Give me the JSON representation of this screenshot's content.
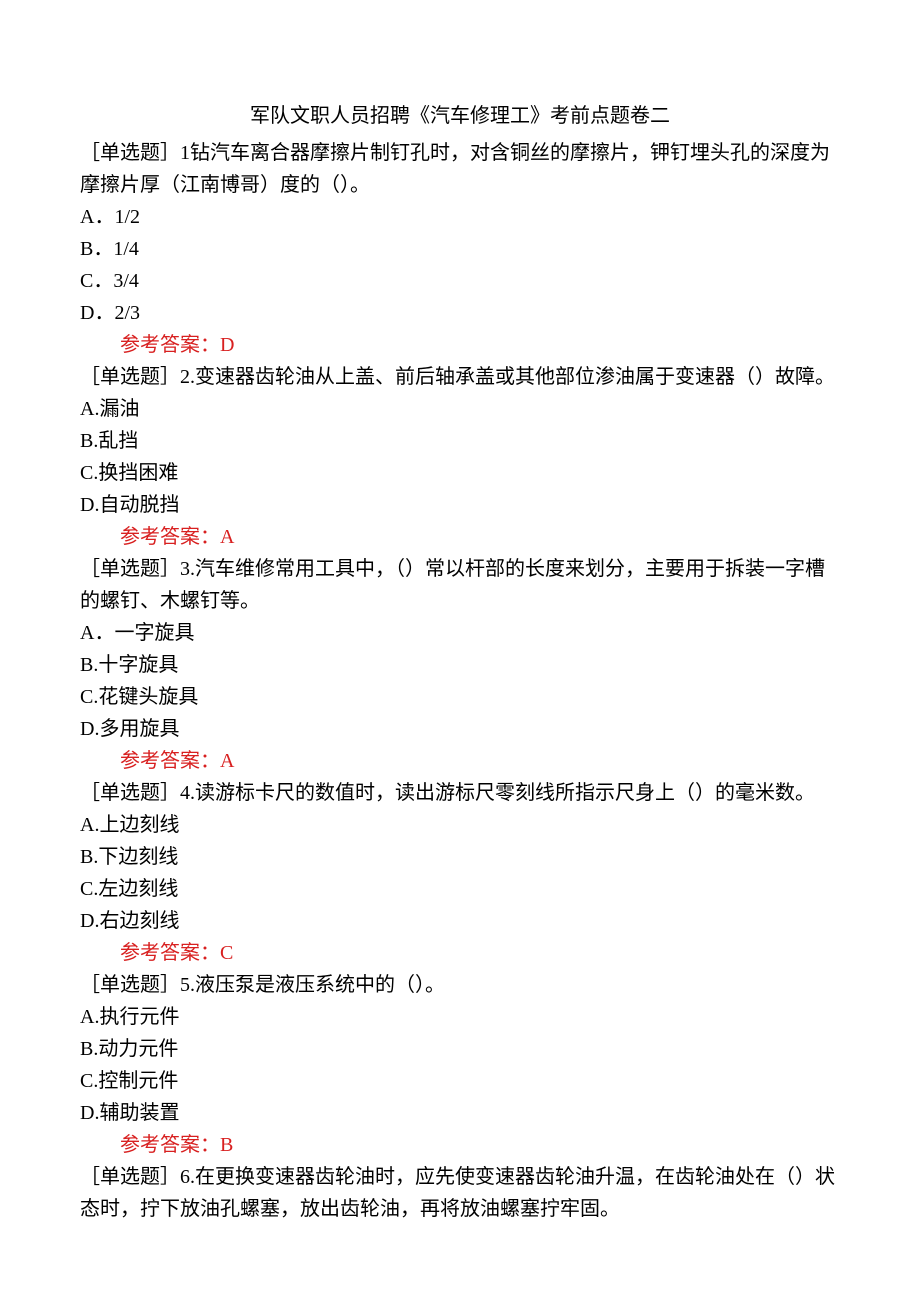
{
  "title": "军队文职人员招聘《汽车修理工》考前点题卷二",
  "questions": [
    {
      "label": "［单选题］1钻汽车离合器摩擦片制钉孔时，对含铜丝的摩擦片，钾钉埋头孔的深度为摩擦片厚（江南博哥）度的（）。",
      "options": {
        "a": "A．1/2",
        "b": "B．1/4",
        "c": "C．3/4",
        "d": "D．2/3"
      },
      "answer": "参考答案：D"
    },
    {
      "label": "［单选题］2.变速器齿轮油从上盖、前后轴承盖或其他部位渗油属于变速器（）故障。",
      "options": {
        "a": "A.漏油",
        "b": "B.乱挡",
        "c": "C.换挡困难",
        "d": "D.自动脱挡"
      },
      "answer": "参考答案：A"
    },
    {
      "label": "［单选题］3.汽车维修常用工具中，（）常以杆部的长度来划分，主要用于拆装一字槽的螺钉、木螺钉等。",
      "options": {
        "a": "A．一字旋具",
        "b": "B.十字旋具",
        "c": "C.花键头旋具",
        "d": "D.多用旋具"
      },
      "answer": "参考答案：A"
    },
    {
      "label": "［单选题］4.读游标卡尺的数值时，读出游标尺零刻线所指示尺身上（）的毫米数。",
      "options": {
        "a": "A.上边刻线",
        "b": "B.下边刻线",
        "c": "C.左边刻线",
        "d": "D.右边刻线"
      },
      "answer": "参考答案：C"
    },
    {
      "label": "［单选题］5.液压泵是液压系统中的（）。",
      "options": {
        "a": "A.执行元件",
        "b": "B.动力元件",
        "c": "C.控制元件",
        "d": "D.辅助装置"
      },
      "answer": "参考答案：B"
    },
    {
      "label": "［单选题］6.在更换变速器齿轮油时，应先使变速器齿轮油升温，在齿轮油处在（）状态时，拧下放油孔螺塞，放出齿轮油，再将放油螺塞拧牢固。",
      "options": {},
      "answer": ""
    }
  ]
}
